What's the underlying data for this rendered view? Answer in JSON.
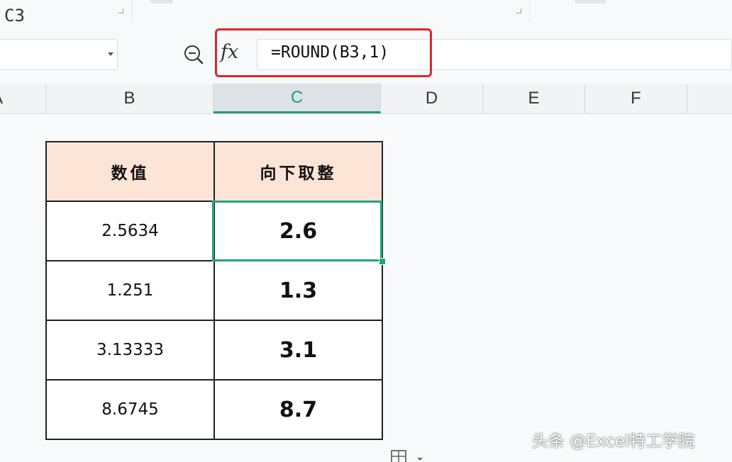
{
  "formula_bar": {
    "name_box": "C3",
    "fx_label": "fx",
    "formula": "=ROUND(B3,1)"
  },
  "columns": {
    "a": "A",
    "b": "B",
    "c": "C",
    "d": "D",
    "e": "E",
    "f": "F"
  },
  "table": {
    "headers": [
      "数值",
      "向下取整"
    ],
    "rows": [
      {
        "value": "2.5634",
        "result": "2.6"
      },
      {
        "value": "1.251",
        "result": "1.3"
      },
      {
        "value": "3.13333",
        "result": "3.1"
      },
      {
        "value": "8.6745",
        "result": "8.7"
      }
    ]
  },
  "watermark": "头条 @Excel特工学院",
  "colors": {
    "accent_green": "#1fa67a",
    "highlight_red": "#e0262a",
    "header_fill": "#fce5d7"
  }
}
